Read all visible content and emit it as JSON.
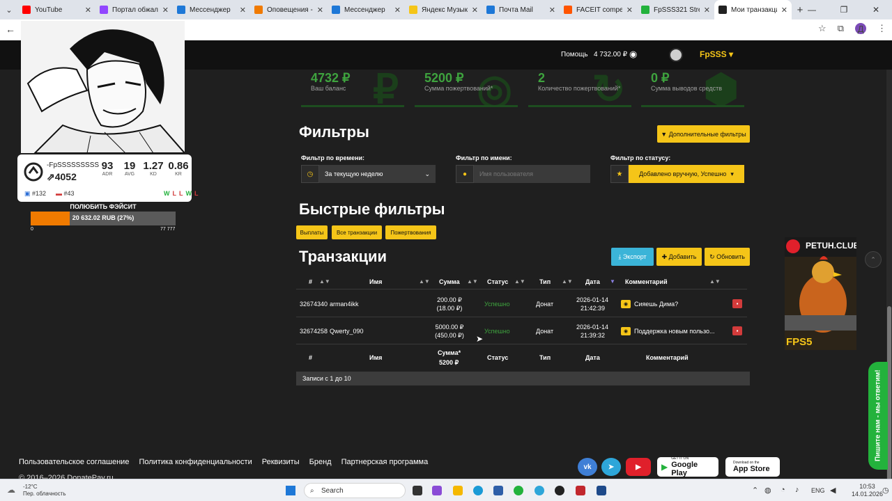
{
  "browser": {
    "tabs": [
      {
        "label": "YouTube",
        "color": "#ff0000"
      },
      {
        "label": "Портал обжалова",
        "color": "#9146ff"
      },
      {
        "label": "Мессенджер",
        "color": "#1e78d7"
      },
      {
        "label": "Оповещения - Во",
        "color": "#f07a00"
      },
      {
        "label": "Мессенджер",
        "color": "#1e78d7"
      },
      {
        "label": "Яндекс Музыка -",
        "color": "#f5c518"
      },
      {
        "label": "Почта Mail",
        "color": "#1e78d7"
      },
      {
        "label": "FACEIT competiti",
        "color": "#ff5500"
      },
      {
        "label": "FpSSS321 Stream",
        "color": "#23b23c"
      },
      {
        "label": "Мои транзакции",
        "color": "#222222"
      }
    ],
    "profile_initial": "Д"
  },
  "header": {
    "help": "Помощь",
    "balance": "4 732.00 ₽",
    "username": "FpSSS"
  },
  "stats": [
    {
      "value": "4732 ₽",
      "label": "Ваш баланс",
      "bg": "₽"
    },
    {
      "value": "5200 ₽",
      "label": "Сумма пожертвований*",
      "bg": "◎"
    },
    {
      "value": "2",
      "label": "Количество пожертвований*",
      "bg": "↻"
    },
    {
      "value": "0 ₽",
      "label": "Сумма выводов средств",
      "bg": "⬢"
    }
  ],
  "filters": {
    "title": "Фильтры",
    "more_button": "Дополнительные фильтры",
    "time_label": "Фильтр по времени:",
    "time_value": "За текущую неделю",
    "name_label": "Фильтр по имени:",
    "name_placeholder": "Имя пользователя",
    "status_label": "Фильтр по статусу:",
    "status_value": "Добавлено вручную, Успешно"
  },
  "quick_filters": {
    "title": "Быстрые фильтры",
    "buttons": [
      "Выплаты",
      "Все транзакции",
      "Пожертвования"
    ]
  },
  "transactions": {
    "title": "Транзакции",
    "export": "Экспорт",
    "add": "Добавить",
    "refresh": "Обновить",
    "columns": [
      "#",
      "Имя",
      "Сумма",
      "Статус",
      "Тип",
      "Дата",
      "Комментарий"
    ],
    "rows": [
      {
        "id": "32674340",
        "name": "arman4ikk",
        "amount": "200.00 ₽",
        "fee": "(18.00 ₽)",
        "status": "Успешно",
        "type": "Донат",
        "date": "2026-01-14",
        "time": "21:42:39",
        "comment": "Сияешь Дима?"
      },
      {
        "id": "32674258",
        "name": "Qwerty_090",
        "amount": "5000.00 ₽",
        "fee": "(450.00 ₽)",
        "status": "Успешно",
        "type": "Донат",
        "date": "2026-01-14",
        "time": "21:39:32",
        "comment": "Поддержка новым пользо..."
      }
    ],
    "footer": {
      "id": "#",
      "name": "Имя",
      "sum_label": "Сумма*",
      "sum_value": "5200 ₽",
      "status": "Статус",
      "type": "Тип",
      "date": "Дата",
      "comment": "Комментарий"
    },
    "records": "Записи с 1 до 10"
  },
  "footer": {
    "links": [
      "Пользовательское соглашение",
      "Политика конфиденциальности",
      "Реквизиты",
      "Бренд",
      "Партнерская программа"
    ],
    "copyright": "© 2016–2026 DonatePay.ru",
    "google_play_small": "GET IT ON",
    "google_play": "Google Play",
    "app_store_small": "Download on the",
    "app_store": "App Store"
  },
  "overlay": {
    "faceit_name": "-FpSSSSSSSSS",
    "faceit_elo": "4052",
    "stats": [
      {
        "value": "93",
        "label": "ADR"
      },
      {
        "value": "19",
        "label": "AVG"
      },
      {
        "value": "1.27",
        "label": "KD"
      },
      {
        "value": "0.86",
        "label": "KR"
      }
    ],
    "rank_1": "#132",
    "rank_2": "#43",
    "recent": [
      "W",
      "L",
      "L",
      "W",
      "L"
    ],
    "goal_title": "ПОЛЮБИТЬ ФЭЙСИТ",
    "goal_text": "20 632.02 RUB (27%)",
    "goal_progress": 27,
    "goal_min": "0",
    "goal_max": "77 777",
    "promo_title": "PETUH.CLUB",
    "promo_code": "FPS5",
    "chat": "Пишите нам - мы ответим!"
  },
  "taskbar": {
    "weather_temp": "-12°C",
    "weather_desc": "Пер. облачность",
    "search": "Search",
    "lang": "ENG",
    "time": "10:53",
    "date": "14.01.2026"
  }
}
